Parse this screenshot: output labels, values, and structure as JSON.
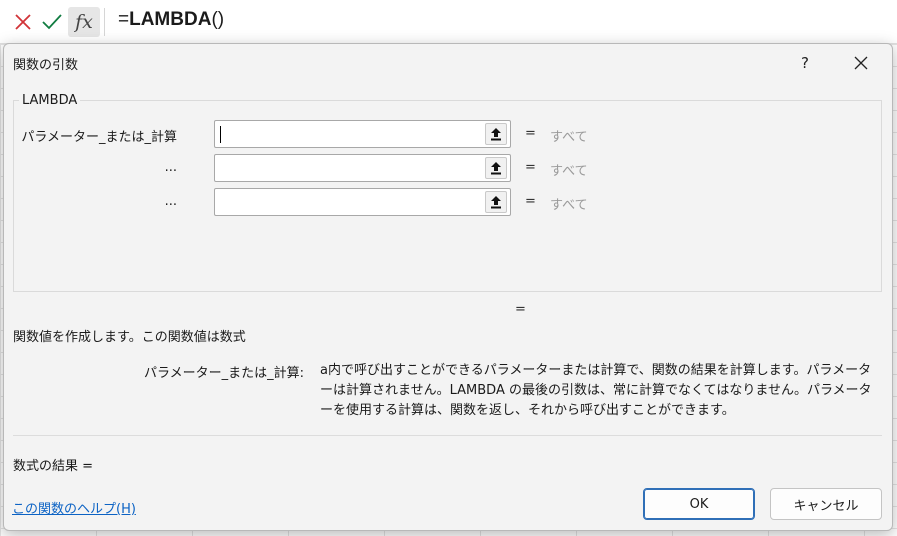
{
  "formula_bar": {
    "prefix": "=",
    "function_name": "LAMBDA",
    "parens": "()",
    "fx_label": "fx"
  },
  "dialog": {
    "title": "関数の引数",
    "help_symbol": "?",
    "group_label": "LAMBDA",
    "args": [
      {
        "label": "パラメーター_または_計算",
        "value": "",
        "eq": "=",
        "result": "すべて"
      },
      {
        "label": "...",
        "value": "",
        "eq": "=",
        "result": "すべて"
      },
      {
        "label": "...",
        "value": "",
        "eq": "=",
        "result": "すべて"
      }
    ],
    "overall_eq": "=",
    "description": "関数値を作成します。この関数値は数式",
    "param_name": "パラメーター_または_計算:",
    "param_description": "a内で呼び出すことができるパラメーターまたは計算で、関数の結果を計算します。パラメーターは計算されません。LAMBDA の最後の引数は、常に計算でなくてはなりません。パラメーターを使用する計算は、関数を返し、それから呼び出すことができます。",
    "result_label": "数式の結果 =",
    "help_link": "この関数のヘルプ(H)",
    "ok_label": "OK",
    "cancel_label": "キャンセル"
  },
  "colors": {
    "link": "#0b62c4",
    "ok_border": "#2f6fb7",
    "cancel_icon": "#d13438",
    "enter_icon": "#107c41"
  }
}
